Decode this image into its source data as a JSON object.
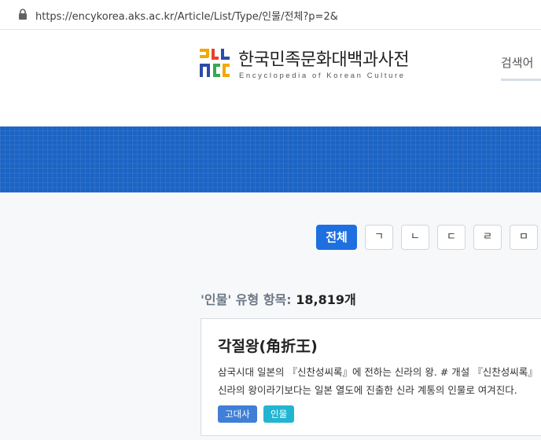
{
  "browser": {
    "url": "https://encykorea.aks.ac.kr/Article/List/Type/인물/전체?p=2&"
  },
  "header": {
    "logo_title": "한국민족문화대백과사전",
    "logo_subtitle": "Encyclopedia of Korean Culture",
    "search_label": "검색어"
  },
  "index": {
    "buttons": [
      "전체",
      "ㄱ",
      "ㄴ",
      "ㄷ",
      "ㄹ",
      "ㅁ"
    ],
    "active": "전체"
  },
  "listing": {
    "type_label": "'인물' 유형 항목:",
    "count": "18,819개"
  },
  "article": {
    "title": "각절왕(角折王)",
    "summary_line1": "삼국시대 일본의 『신찬성씨록』에 전하는 신라의 왕. # 개설 『신찬성씨록』",
    "summary_line2": "신라의 왕이라기보다는 일본 열도에 진출한 신라 계통의 인물로 여겨진다.",
    "tags": [
      {
        "label": "고대사",
        "color": "#3f7fd6"
      },
      {
        "label": "인물",
        "color": "#22b5d1"
      }
    ]
  },
  "colors": {
    "banner": "#1c64c4",
    "active_button": "#1e6fe0"
  }
}
